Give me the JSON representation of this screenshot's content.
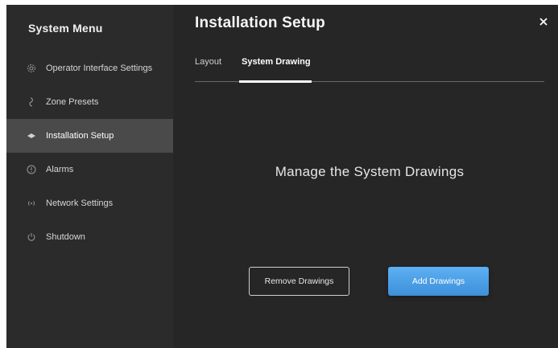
{
  "sidebar": {
    "title": "System Menu",
    "items": [
      {
        "label": "Operator Interface Settings",
        "icon": "gear-icon"
      },
      {
        "label": "Zone Presets",
        "icon": "zone-icon"
      },
      {
        "label": "Installation Setup",
        "icon": "installation-icon",
        "active": true
      },
      {
        "label": "Alarms",
        "icon": "alert-icon"
      },
      {
        "label": "Network Settings",
        "icon": "wifi-icon"
      },
      {
        "label": "Shutdown",
        "icon": "power-icon"
      }
    ]
  },
  "main": {
    "title": "Installation Setup",
    "tabs": [
      {
        "label": "Layout"
      },
      {
        "label": "System Drawing",
        "active": true
      }
    ],
    "heading": "Manage the System Drawings",
    "buttons": {
      "remove_label": "Remove Drawings",
      "add_label": "Add Drawings"
    }
  },
  "colors": {
    "background": "#262626",
    "sidebar": "#2b2b2b",
    "active_item": "#4a4a4a",
    "accent": "#4a9ee6"
  }
}
